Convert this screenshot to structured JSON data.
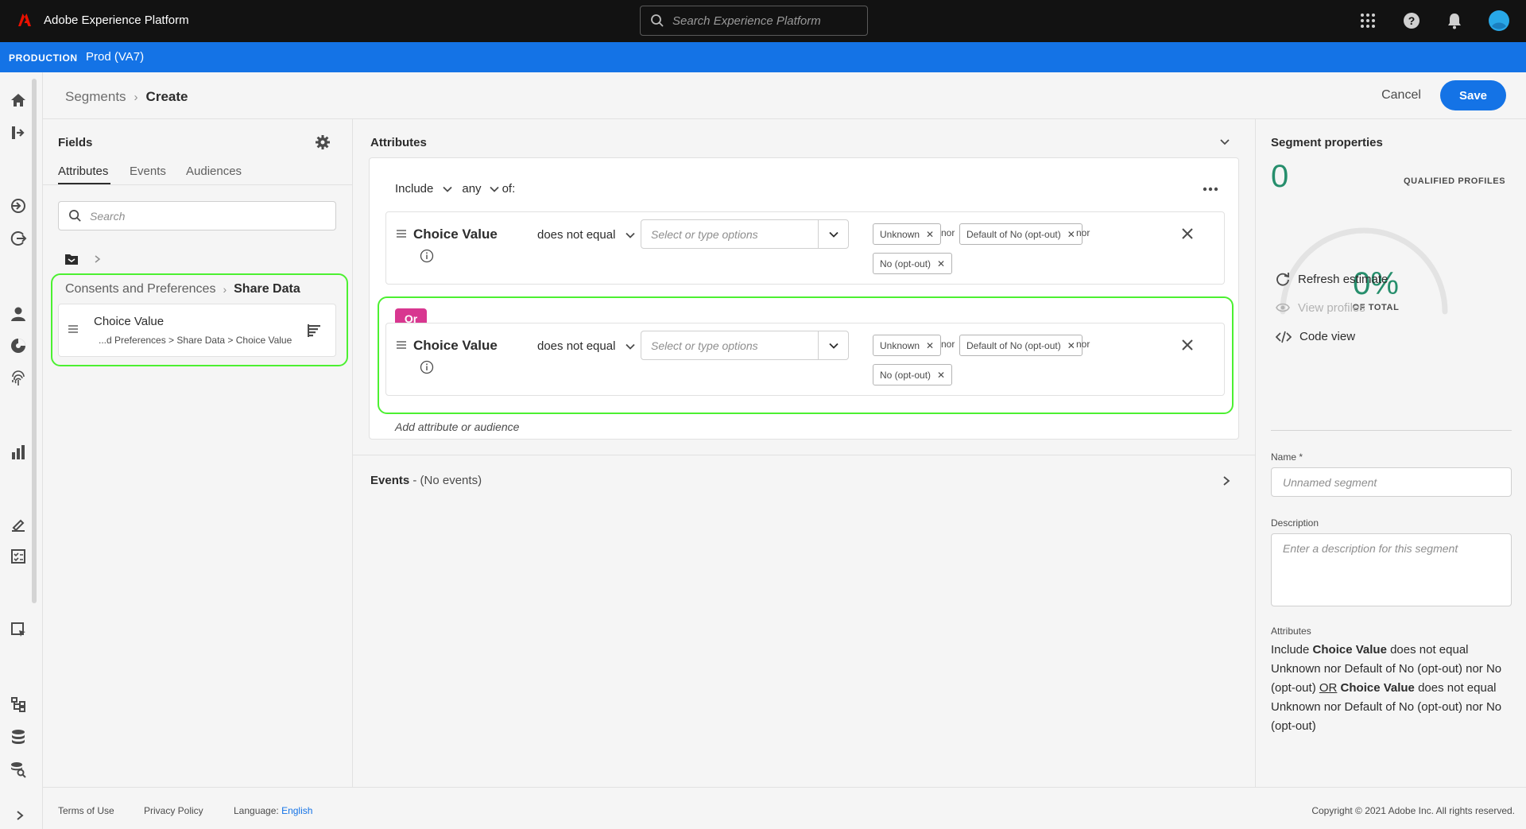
{
  "app": {
    "title": "Adobe Experience Platform",
    "search_placeholder": "Search Experience Platform",
    "icons": [
      "apps-grid-icon",
      "help-icon",
      "notifications-icon",
      "user-avatar"
    ]
  },
  "sandbox": {
    "label": "PRODUCTION",
    "name": "Prod (VA7)"
  },
  "rail": {
    "icons": [
      "home-icon",
      "workflows-icon",
      "sources-icon",
      "destinations-icon",
      "profiles-icon",
      "segments-icon",
      "identities-icon",
      "privacy-icon",
      "policies-icon",
      "queries-icon",
      "schemas-icon",
      "datasets-icon",
      "data-monitoring-icon",
      "expand-icon"
    ]
  },
  "header": {
    "breadcrumb_parent": "Segments",
    "breadcrumb_current": "Create",
    "cancel_label": "Cancel",
    "save_label": "Save"
  },
  "fields": {
    "title": "Fields",
    "tabs": [
      {
        "label": "Attributes",
        "active": true
      },
      {
        "label": "Events",
        "active": false
      },
      {
        "label": "Audiences",
        "active": false
      }
    ],
    "search_placeholder": "Search",
    "path_parent": "Consents and Preferences",
    "path_current": "Share Data",
    "field_item": {
      "name": "Choice Value",
      "path": "...d Preferences > Share Data > Choice Value"
    }
  },
  "canvas": {
    "section_title": "Attributes",
    "include_label": "Include",
    "any_label": "any",
    "of_label": "of:",
    "or_label": "Or",
    "add_label": "Add attribute or audience",
    "conditions": [
      {
        "name": "Choice Value",
        "operator": "does not equal",
        "select_placeholder": "Select or type options",
        "tags": [
          "Unknown",
          "Default of No (opt-out)",
          "No (opt-out)"
        ],
        "joiner": "nor"
      },
      {
        "name": "Choice Value",
        "operator": "does not equal",
        "select_placeholder": "Select or type options",
        "tags": [
          "Unknown",
          "Default of No (opt-out)",
          "No (opt-out)"
        ],
        "joiner": "nor"
      }
    ],
    "events_title": "Events",
    "events_sub": " - (No events)"
  },
  "props": {
    "title": "Segment properties",
    "count": "0",
    "qualified_label": "QUALIFIED PROFILES",
    "percent": "0%",
    "of_total": "OF TOTAL",
    "refresh_label": "Refresh estimate",
    "view_profiles_label": "View profiles",
    "code_view_label": "Code view",
    "name_label": "Name *",
    "name_placeholder": "Unnamed segment",
    "desc_label": "Description",
    "desc_placeholder": "Enter a description for this segment",
    "attributes_label": "Attributes",
    "summary": {
      "p1": "Include ",
      "b1": "Choice Value",
      "p2": " does not equal Unknown nor Default of No (opt-out) nor No (opt-out) ",
      "or": "OR",
      "p3": " ",
      "b2": "Choice Value",
      "p4": " does not equal Unknown nor Default of No (opt-out) nor No (opt-out)"
    }
  },
  "footer": {
    "terms": "Terms of Use",
    "privacy": "Privacy Policy",
    "language_label": "Language: ",
    "language_value": "English",
    "copyright": "Copyright ©  2021 Adobe Inc.  All rights reserved."
  },
  "colors": {
    "brand_blue": "#1473e6",
    "highlight_green": "#4cf031",
    "or_badge": "#d83790",
    "estimate_green": "#268e6c"
  }
}
